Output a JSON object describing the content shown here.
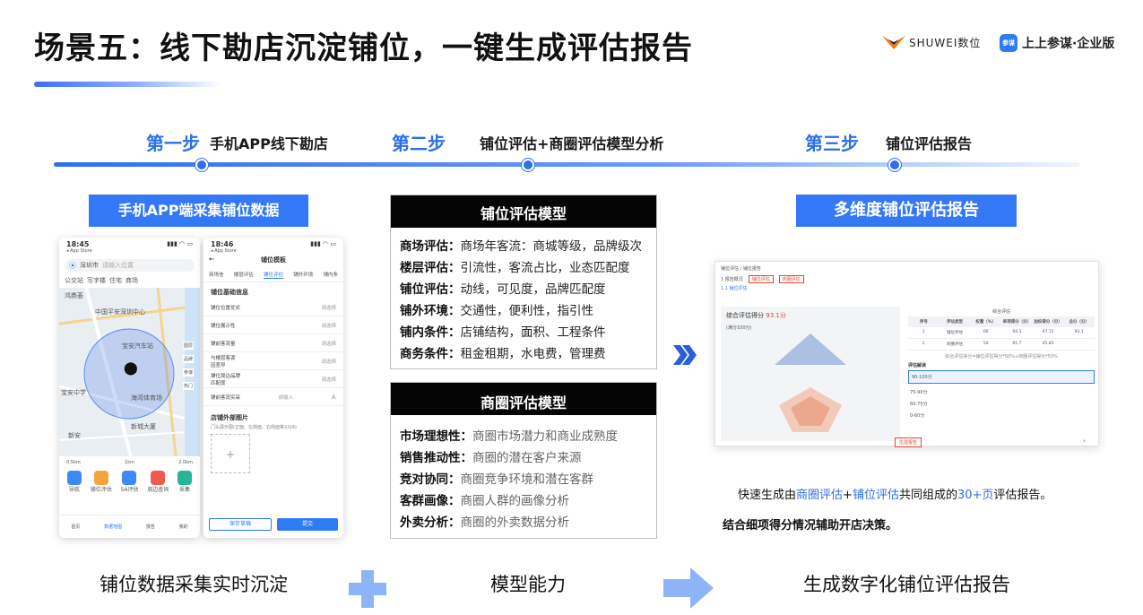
{
  "header": {
    "title": "场景五：线下勘店沉淀铺位，一键生成评估报告",
    "logo_shuwei": "SHUWEI数位",
    "logo_shangshang": "上上参谋·企业版",
    "logo_shangshang_badge": "参谋"
  },
  "steps": [
    {
      "label": "第一步",
      "desc": "手机APP线下勘店"
    },
    {
      "label": "第二步",
      "desc": "铺位评估+商圈评估模型分析"
    },
    {
      "label": "第三步",
      "desc": "铺位评估报告"
    }
  ],
  "left": {
    "header": "手机APP端采集铺位数据",
    "phone1": {
      "time": "18:45",
      "store": "◂ App Store",
      "city": "深圳市",
      "search_placeholder": "请输入位置",
      "chips": [
        "公交站",
        "写字楼",
        "住宅",
        "商场"
      ],
      "map_labels": [
        "鸿鼎荟",
        "中国平安深圳中心",
        "宝安汽车站",
        "海湾体育场",
        "宝安中学",
        "新城大厦",
        "新安"
      ],
      "side_icons": [
        "图层",
        "品牌",
        "参谋",
        "热门"
      ],
      "scale_labels": [
        "0.5km",
        "1km",
        "2.0km"
      ],
      "tools": [
        "导航",
        "铺位评估",
        "5A评估",
        "周边查询",
        "采集"
      ],
      "tabs": [
        "首页",
        "数据地图",
        "报告",
        "我的"
      ]
    },
    "phone2": {
      "time": "18:46",
      "store": "◂ App Store",
      "title": "铺位模板",
      "tabs": [
        "商场信",
        "楼层评估",
        "铺位评估",
        "铺外环境",
        "铺内条"
      ],
      "section": "铺位基础信息",
      "fields": [
        {
          "label": "铺位位置优劣",
          "value": "请选择"
        },
        {
          "label": "铺位展示性",
          "value": "请选择"
        },
        {
          "label": "铺前客流量",
          "value": "请选择"
        },
        {
          "label": "与楼层客源\n因差异",
          "value": "请选择"
        },
        {
          "label": "铺位周边品牌\n匹配度",
          "value": "请选择"
        },
        {
          "label": "铺前客流实采",
          "value": "请输入"
        }
      ],
      "unit": "人",
      "photo_section": "店铺外部图片",
      "photo_hint": "门头展示图(正面、左侧面、右侧面等)(0/4)",
      "draft_button": "保存草稿",
      "submit_button": "提交"
    },
    "bottom_label": "铺位数据采集实时沉淀"
  },
  "middle": {
    "model1_title": "铺位评估模型",
    "model1_rows": [
      {
        "k": "商场评估：",
        "v": "商场年客流：商城等级，品牌级次"
      },
      {
        "k": "楼层评估：",
        "v": "引流性，客流占比，业态匹配度"
      },
      {
        "k": "铺位评估：",
        "v": "动线，可见度，品牌匹配度"
      },
      {
        "k": "铺外环境：",
        "v": "交通性，便利性，指引性"
      },
      {
        "k": "铺内条件：",
        "v": "店铺结构，面积、工程条件"
      },
      {
        "k": "商务条件：",
        "v": "租金租期，水电费，管理费"
      }
    ],
    "model2_title": "商圈评估模型",
    "model2_rows": [
      {
        "k": "市场理想性：",
        "v": "商圈市场潜力和商业成熟度"
      },
      {
        "k": "销售推动性：",
        "v": "商圈的潜在客户来源"
      },
      {
        "k": "竞对协同：",
        "v": "商圈竞争环境和潜在客群"
      },
      {
        "k": "客群画像：",
        "v": "商圈人群的画像分析"
      },
      {
        "k": "外卖分析：",
        "v": "商圈的外卖数据分析"
      }
    ],
    "bottom_label": "模型能力"
  },
  "right": {
    "header": "多维度铺位评估报告",
    "report": {
      "breadcrumb": "铺位评估 / 铺位报告",
      "tab_a": "1 报告概况",
      "tab_b": "铺位评估",
      "tab_c": "商圈评估",
      "sub_tab": "1.1 铺位评估",
      "score_title": "综合评估得分",
      "score_value": "93.1分",
      "score_sub": "(满分100分)",
      "table_title": "综合评估",
      "table_headers": [
        "序号",
        "评估类型",
        "权重（%）",
        "单项得分（分）",
        "加权得分（分）",
        "总分（分）"
      ],
      "table_rows": [
        [
          "1",
          "铺位评估",
          "60",
          "94.3",
          "47.15",
          "93.1"
        ],
        [
          "2",
          "商圈评估",
          "50",
          "91.7",
          "45.85",
          ""
        ]
      ],
      "table_note": "综合评估得分=铺位评估得分*50%+商圈评估得分*50%",
      "interp_title": "评估解读",
      "interp_items": [
        "90-100分",
        "75-90分",
        "60-75分",
        "0-60分"
      ],
      "button": "生成报告"
    },
    "desc_prefix": "快速生成由",
    "desc_a": "商圈评估",
    "desc_plus": "+",
    "desc_b": "铺位评估",
    "desc_mid": "共同组成的",
    "desc_c": "30+页",
    "desc_suffix": "评估报告。",
    "desc2": "结合细项得分情况辅助开店决策。",
    "bottom_label": "生成数字化铺位评估报告"
  },
  "colors": {
    "accent": "#3478f6",
    "step": "#2b6fe8",
    "black": "#050505",
    "plus": "#8eb4f8"
  }
}
